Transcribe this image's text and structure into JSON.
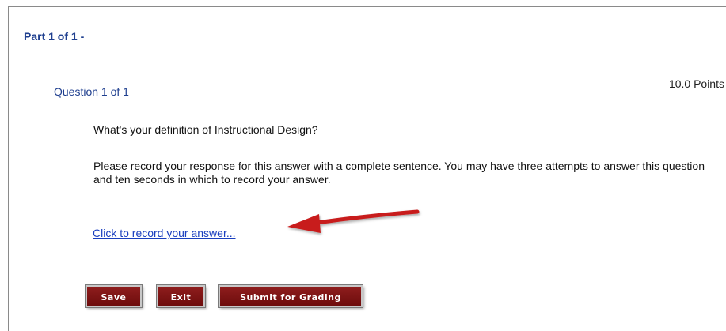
{
  "header": {
    "part_title": "Part 1 of 1 -"
  },
  "question": {
    "number_label": "Question 1 of 1",
    "points": "10.0 Points",
    "text": "What's your definition of Instructional Design?",
    "instructions": "Please record your response for this answer with a complete sentence. You may have three attempts to answer this question and ten seconds in which to record your answer.",
    "record_link": "Click to record your answer..."
  },
  "buttons": {
    "save": "Save",
    "exit": "Exit",
    "submit": "Submit for Grading"
  },
  "colors": {
    "title_blue": "#1f3f8f",
    "link_blue": "#1a3fbf",
    "button_red": "#7a1212",
    "arrow_red": "#c81e1e"
  },
  "icons": {
    "arrow": "red-arrow-pointing-left"
  }
}
